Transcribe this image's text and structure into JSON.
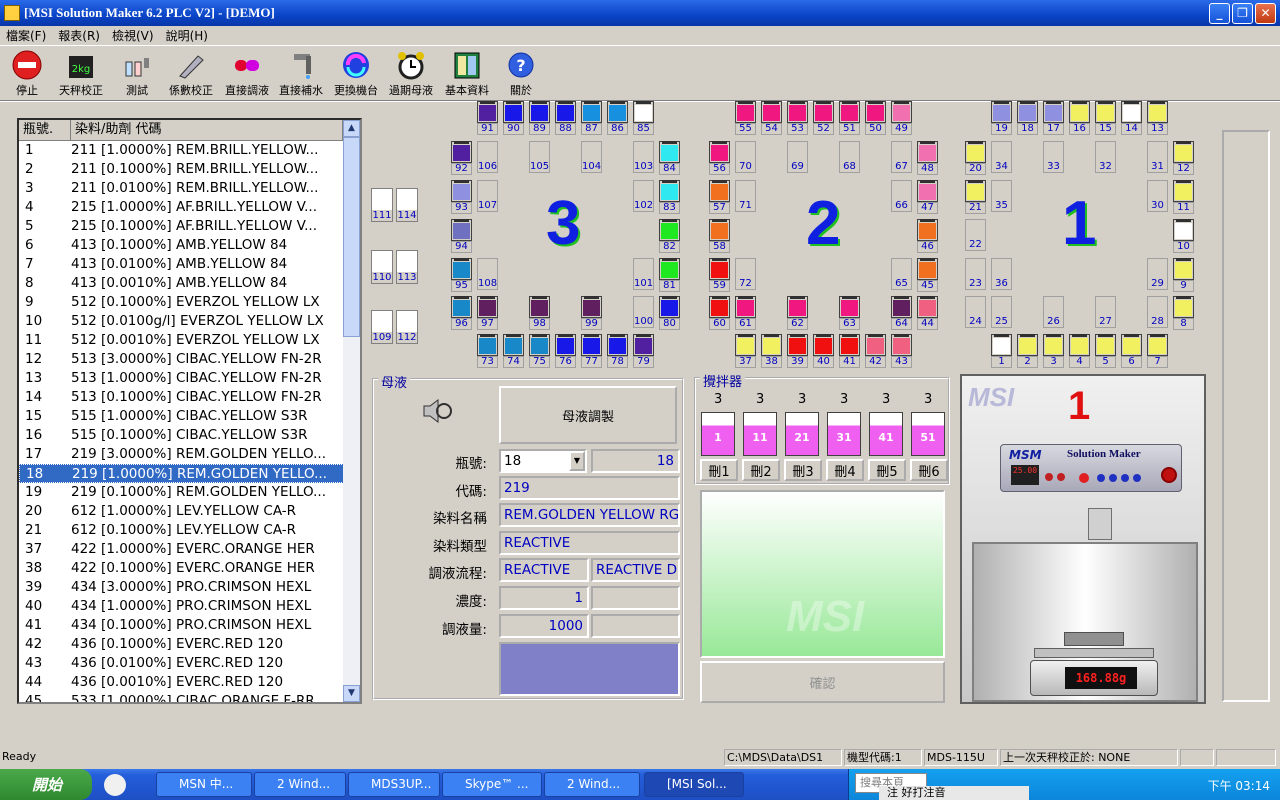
{
  "window": {
    "title": "[MSI Solution Maker 6.2 PLC V2] - [DEMO]"
  },
  "menu": [
    "檔案(F)",
    "報表(R)",
    "檢視(V)",
    "說明(H)"
  ],
  "toolbar": [
    {
      "label": "停止",
      "icon": "stop-icon"
    },
    {
      "label": "天秤校正",
      "icon": "scale-icon"
    },
    {
      "label": "測試",
      "icon": "test-icon"
    },
    {
      "label": "係數校正",
      "icon": "coefficient-icon"
    },
    {
      "label": "直接調液",
      "icon": "capsule-icon"
    },
    {
      "label": "直接補水",
      "icon": "faucet-icon"
    },
    {
      "label": "更換機台",
      "icon": "swap-icon"
    },
    {
      "label": "過期母液",
      "icon": "alarm-clock-icon"
    },
    {
      "label": "基本資料",
      "icon": "book-icon"
    },
    {
      "label": "關於",
      "icon": "help-icon"
    }
  ],
  "list": {
    "headers": [
      "瓶號.",
      "染料/助劑 代碼"
    ],
    "selected_index": 17,
    "rows": [
      [
        "1",
        "211 [1.0000%] REM.BRILL.YELLOW..."
      ],
      [
        "2",
        "211 [0.1000%] REM.BRILL.YELLOW..."
      ],
      [
        "3",
        "211 [0.0100%] REM.BRILL.YELLOW..."
      ],
      [
        "4",
        "215 [1.0000%] AF.BRILL.YELLOW V..."
      ],
      [
        "5",
        "215 [0.1000%] AF.BRILL.YELLOW V..."
      ],
      [
        "6",
        "413 [0.1000%] AMB.YELLOW 84"
      ],
      [
        "7",
        "413 [0.0100%] AMB.YELLOW 84"
      ],
      [
        "8",
        "413 [0.0010%] AMB.YELLOW 84"
      ],
      [
        "9",
        "512 [0.1000%] EVERZOL YELLOW LX"
      ],
      [
        "10",
        "512 [0.0100g/l] EVERZOL YELLOW LX"
      ],
      [
        "11",
        "512 [0.0010%] EVERZOL YELLOW LX"
      ],
      [
        "12",
        "513 [3.0000%] CIBAC.YELLOW FN-2R"
      ],
      [
        "13",
        "513 [1.0000%] CIBAC.YELLOW FN-2R"
      ],
      [
        "14",
        "513 [0.1000%] CIBAC.YELLOW FN-2R"
      ],
      [
        "15",
        "515 [1.0000%] CIBAC.YELLOW S3R"
      ],
      [
        "16",
        "515 [0.1000%] CIBAC.YELLOW S3R"
      ],
      [
        "17",
        "219 [3.0000%] REM.GOLDEN YELLO..."
      ],
      [
        "18",
        "219 [1.0000%] REM.GOLDEN YELLO..."
      ],
      [
        "19",
        "219 [0.1000%] REM.GOLDEN YELLO..."
      ],
      [
        "20",
        "612 [1.0000%] LEV.YELLOW CA-R"
      ],
      [
        "21",
        "612 [0.1000%] LEV.YELLOW CA-R"
      ],
      [
        "37",
        "422 [1.0000%] EVERC.ORANGE HER"
      ],
      [
        "38",
        "422 [0.1000%] EVERC.ORANGE HER"
      ],
      [
        "39",
        "434 [3.0000%] PRO.CRIMSON HEXL"
      ],
      [
        "40",
        "434 [1.0000%] PRO.CRIMSON HEXL"
      ],
      [
        "41",
        "434 [0.1000%] PRO.CRIMSON HEXL"
      ],
      [
        "42",
        "436 [0.1000%] EVERC.RED 120"
      ],
      [
        "43",
        "436 [0.0100%] EVERC.RED 120"
      ],
      [
        "44",
        "436 [0.0010%] EVERC.RED 120"
      ],
      [
        "45",
        "533 [1.0000%] CIBAC.ORANGE F-RR"
      ]
    ]
  },
  "rack": {
    "groups": [
      "3",
      "2",
      "1"
    ],
    "left_slots": [
      "111",
      "114",
      "110",
      "113",
      "109",
      "112"
    ]
  },
  "stock": {
    "title": "母液",
    "make_button": "母液調製",
    "labels": {
      "bottle": "瓶號:",
      "code": "代碼:",
      "dye_name": "染料名稱",
      "dye_type": "染料類型",
      "process": "調液流程:",
      "concentration": "濃度:",
      "amount": "調液量:"
    },
    "bottle_select": "18",
    "bottle_no": "18",
    "code": "219",
    "dye_name": "REM.GOLDEN YELLOW RG",
    "dye_type": "REACTIVE",
    "process_1": "REACTIVE",
    "process_2": "REACTIVE D",
    "concentration": "1",
    "amount": "1000",
    "color_swatch": "#8080c8"
  },
  "mixer": {
    "title": "攪拌器",
    "counts": [
      "3",
      "3",
      "3",
      "3",
      "3",
      "3"
    ],
    "cups": [
      "1",
      "11",
      "21",
      "31",
      "41",
      "51"
    ],
    "delete_buttons": [
      "刪1",
      "刪2",
      "刪3",
      "刪4",
      "刪5",
      "刪6"
    ],
    "confirm": "確認",
    "watermark": "MSI"
  },
  "machine": {
    "logo": "MSI",
    "number": "1",
    "brand": "MSM",
    "product": "Solution Maker",
    "display": "25.00",
    "scale_reading": "168.88g"
  },
  "status": {
    "ready": "Ready",
    "path": "C:\\MDS\\Data\\DS1",
    "machine_code": "機型代碼:1",
    "model": "MDS-115U",
    "last_cal": "上一次天秤校正於: NONE"
  },
  "taskbar": {
    "start": "開始",
    "items": [
      "MSN 中...",
      "2 Wind...",
      "MDS3UP...",
      "Skype™ ...",
      "2 Wind...",
      "[MSI Sol..."
    ],
    "clock": "下午 03:14",
    "ime": "注 好打注音",
    "search": "搜尋本頁"
  }
}
